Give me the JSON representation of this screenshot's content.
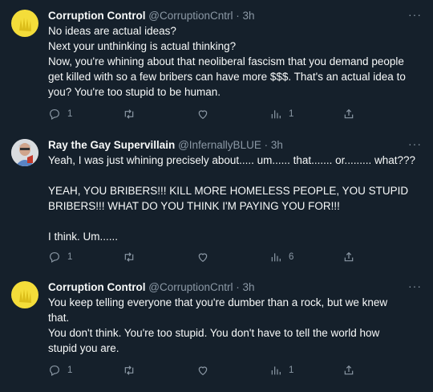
{
  "tweets": [
    {
      "name": "Corruption Control",
      "handle": "@CorruptionCntrl",
      "time": "· 3h",
      "lines": [
        "No ideas are actual ideas?",
        "Next your unthinking is actual thinking?",
        "Now, you're whining about that neoliberal fascism that you demand people",
        "get killed with so a few bribers can have more $$$.  That's an actual idea to",
        "you?  You're too stupid to be human."
      ],
      "replies": "1",
      "retweets": "",
      "likes": "",
      "views": "1"
    },
    {
      "name": "Ray the Gay Supervillain",
      "handle": "@InfernallyBLUE",
      "time": "· 3h",
      "lines": [
        "Yeah, I was just whining precisely about..... um...... that....... or......... what???",
        "",
        "YEAH, YOU BRIBERS!!! KILL MORE HOMELESS PEOPLE, YOU STUPID",
        "BRIBERS!!! WHAT DO YOU THINK I'M PAYING YOU FOR!!!",
        "",
        "I think. Um......"
      ],
      "replies": "1",
      "retweets": "",
      "likes": "",
      "views": "6"
    },
    {
      "name": "Corruption Control",
      "handle": "@CorruptionCntrl",
      "time": "· 3h",
      "lines": [
        "You keep telling everyone that you're dumber than a rock, but we knew",
        "that.",
        "You don't think.  You're too stupid.  You don't have to tell the world how",
        "stupid you are."
      ],
      "replies": "1",
      "retweets": "",
      "likes": "",
      "views": "1"
    }
  ],
  "more_label": "···",
  "icons": [
    "reply-icon",
    "retweet-icon",
    "like-icon",
    "views-icon",
    "share-icon"
  ],
  "colors": {
    "background": "#15202b",
    "text": "#f7f9f9",
    "muted": "#8b98a5",
    "avatar_yellow": "#f4dd3a"
  }
}
